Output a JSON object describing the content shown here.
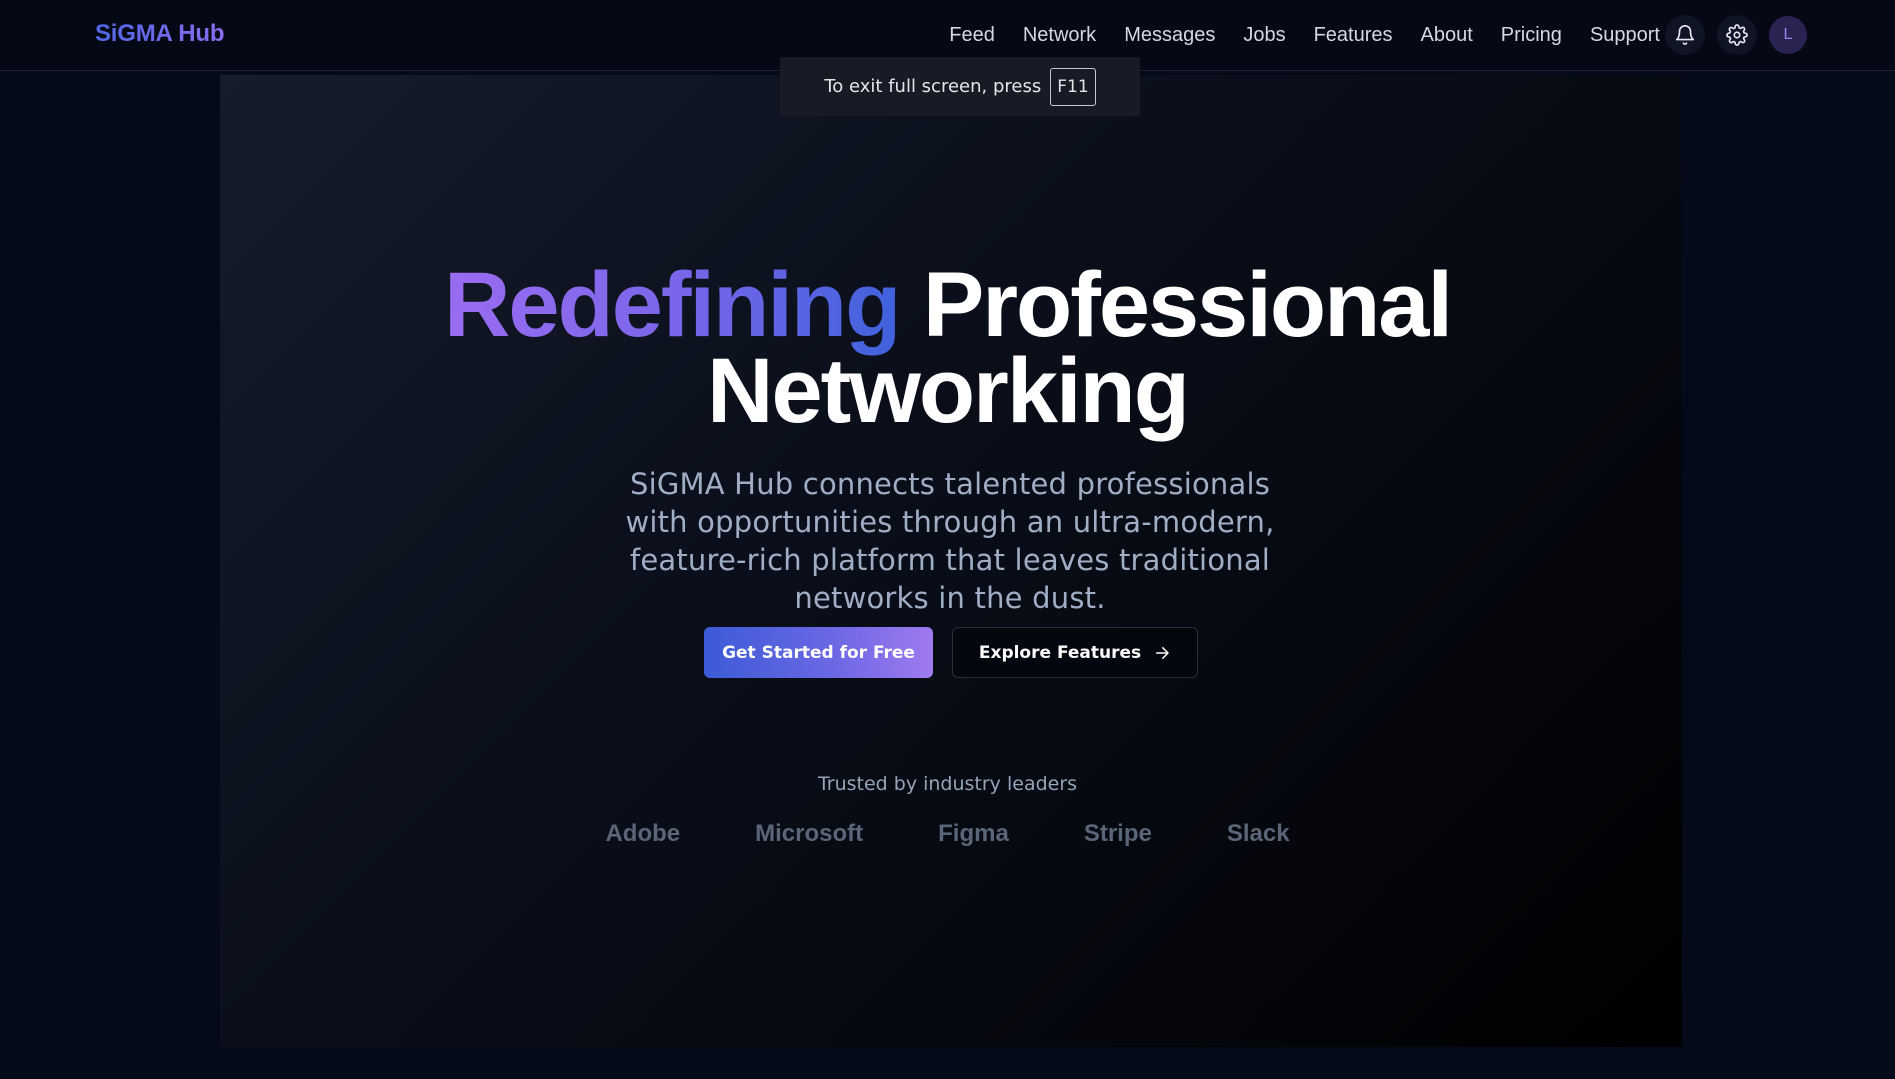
{
  "header": {
    "brand": "SiGMA Hub",
    "nav": [
      "Feed",
      "Network",
      "Messages",
      "Jobs",
      "Features",
      "About",
      "Pricing",
      "Support"
    ],
    "avatar_initial": "L",
    "icons": [
      "bell-icon",
      "gear-icon"
    ]
  },
  "fullscreen_toast": {
    "text": "To exit full screen, press",
    "key": "F11"
  },
  "hero": {
    "headline_accent": "Redefining",
    "headline_line1_rest": "Professional",
    "headline_line2": "Networking",
    "subtitle": "SiGMA Hub connects talented professionals with opportunities through an ultra-modern, feature-rich platform that leaves traditional networks in the dust.",
    "primary_cta": "Get Started for Free",
    "secondary_cta": "Explore Features",
    "trusted_label": "Trusted by industry leaders",
    "logos": [
      "Adobe",
      "Microsoft",
      "Figma",
      "Stripe",
      "Slack"
    ]
  },
  "colors": {
    "background": "#050a1a",
    "accent_purple": "#9a6cf0",
    "accent_blue": "#3f62dc"
  }
}
